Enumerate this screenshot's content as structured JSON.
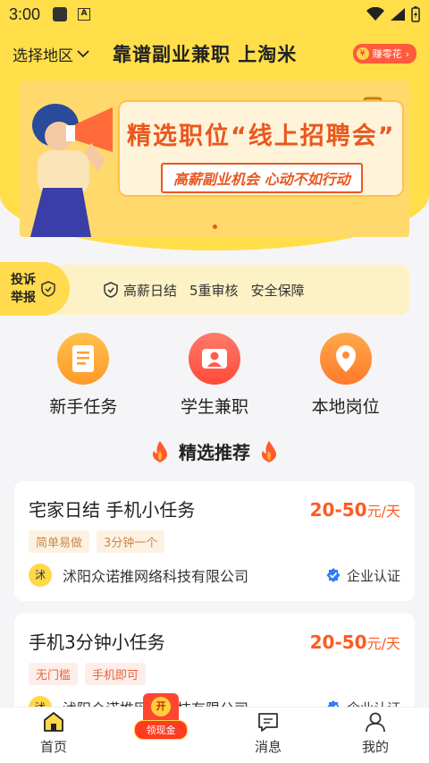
{
  "status_bar": {
    "time": "3:00"
  },
  "header": {
    "region_label": "选择地区",
    "title": "靠谱副业兼职 上淘米",
    "earn_button": "赚零花",
    "earn_coin": "¥"
  },
  "banner": {
    "title": "精选职位“线上招聘会”",
    "subtitle": "高薪副业机会 心动不如行动"
  },
  "trust_bar": {
    "report_line1": "投诉",
    "report_line2": "举报",
    "items": [
      "高薪日结",
      "5重审核",
      "安全保障"
    ]
  },
  "quick_links": [
    {
      "label": "新手任务",
      "icon": "task-list-icon",
      "color": "#ff9f2e"
    },
    {
      "label": "学生兼职",
      "icon": "student-icon",
      "color": "#ff5a4a"
    },
    {
      "label": "本地岗位",
      "icon": "location-pin-icon",
      "color": "#ff8a3a"
    }
  ],
  "recommend": {
    "title": "精选推荐"
  },
  "jobs": [
    {
      "title": "宅家日结 手机小任务",
      "salary": "20-50",
      "salary_unit": "元/天",
      "tags": [
        "简单易做",
        "3分钟一个"
      ],
      "company_avatar": "沭",
      "company": "沭阳众诺推网络科技有限公司",
      "verified": "企业认证"
    },
    {
      "title": "手机3分钟小任务",
      "salary": "20-50",
      "salary_unit": "元/天",
      "tags": [
        "无门槛",
        "手机即可"
      ],
      "company_avatar": "沭",
      "company": "沭阳众诺推网络科技有限公司",
      "verified": "企业认证"
    }
  ],
  "tabbar": {
    "home": "首页",
    "cash_badge": "领现金",
    "cash_open": "开",
    "messages": "消息",
    "mine": "我的"
  },
  "colors": {
    "brand_yellow": "#ffde4a",
    "accent_orange": "#ff5a1f",
    "verified_blue": "#2f7cf6"
  }
}
